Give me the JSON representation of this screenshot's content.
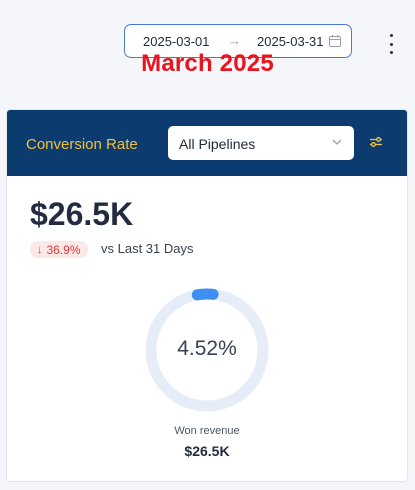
{
  "date_range": {
    "start": "2025-03-01",
    "arrow": "→",
    "end": "2025-03-31"
  },
  "overlay_title": "March 2025",
  "card": {
    "title": "Conversion Rate",
    "pipeline_select": {
      "value": "All Pipelines"
    },
    "metric_value": "$26.5K",
    "change": {
      "value": "36.9%",
      "direction": "down",
      "arrow": "↓",
      "compare_text": "vs Last 31 Days"
    },
    "rate": {
      "label": "4.52%",
      "fraction": 0.0452
    },
    "won_label": "Won revenue",
    "won_value": "$26.5K"
  },
  "colors": {
    "header_bg": "#0b3b6f",
    "title": "#f5c13a",
    "overlay": "#e8141e",
    "ring_track": "#e6edf9",
    "ring_fill": "#3f8ff0",
    "negative": "#d93a3a",
    "negative_bg": "#fde8e8"
  },
  "icons": {
    "calendar": "calendar-icon",
    "more": "more-vertical-icon",
    "chevron": "chevron-down-icon",
    "filter": "filter-sliders-icon",
    "down_arrow": "arrow-down-icon"
  }
}
